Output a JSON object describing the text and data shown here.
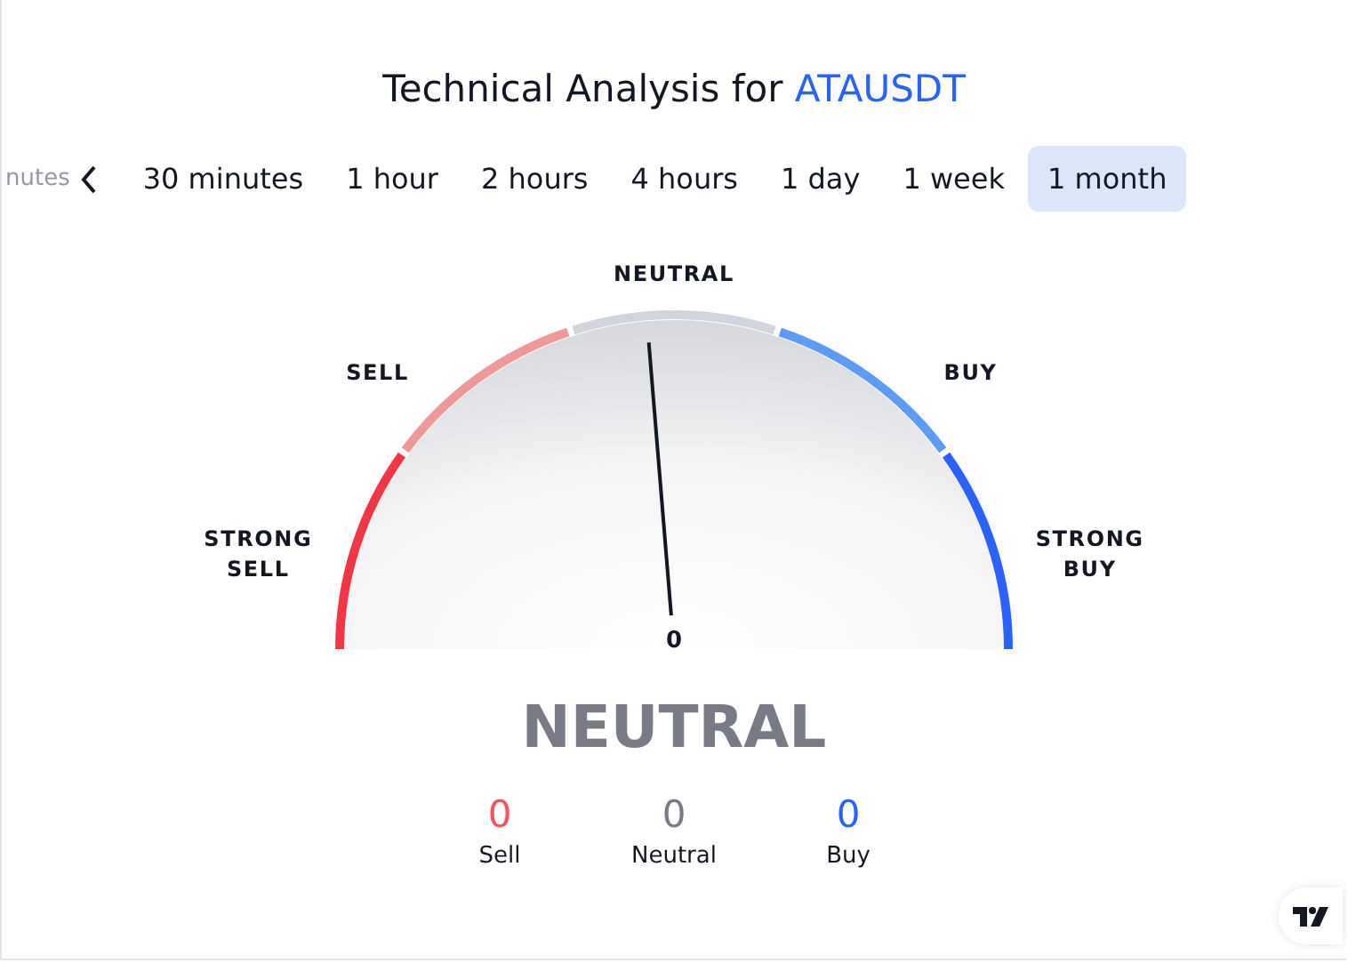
{
  "title": {
    "text": "Technical Analysis for ",
    "symbol": "ATAUSDT"
  },
  "tabs": [
    {
      "label": "nutes",
      "selected": false,
      "faded": true
    },
    {
      "label": "30 minutes",
      "selected": false
    },
    {
      "label": "1 hour",
      "selected": false
    },
    {
      "label": "2 hours",
      "selected": false
    },
    {
      "label": "4 hours",
      "selected": false
    },
    {
      "label": "1 day",
      "selected": false
    },
    {
      "label": "1 week",
      "selected": false
    },
    {
      "label": "1 month",
      "selected": true
    }
  ],
  "gauge": {
    "segments": [
      {
        "label": [
          "STRONG",
          "SELL"
        ],
        "color": "#f23645"
      },
      {
        "label": [
          "SELL"
        ],
        "color": "#f09898"
      },
      {
        "label": [
          "NEUTRAL"
        ],
        "color": "#d1d4dc"
      },
      {
        "label": [
          "BUY"
        ],
        "color": "#5b9cf6"
      },
      {
        "label": [
          "STRONG",
          "BUY"
        ],
        "color": "#2962ff"
      }
    ],
    "reading": "0"
  },
  "verdict": "NEUTRAL",
  "counters": [
    {
      "value": "0",
      "label": "Sell",
      "color": "#f7525f"
    },
    {
      "value": "0",
      "label": "Neutral",
      "color": "#787b86"
    },
    {
      "value": "0",
      "label": "Buy",
      "color": "#2962ff"
    }
  ]
}
